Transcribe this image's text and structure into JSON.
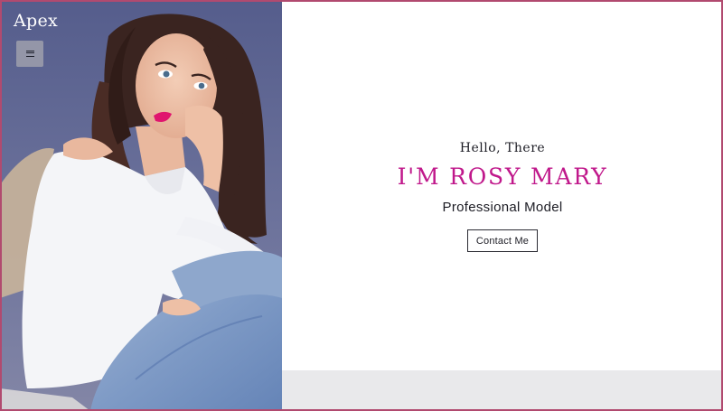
{
  "brand": {
    "name": "Apex"
  },
  "nav": {
    "menu_icon": "hamburger-menu-icon"
  },
  "hero": {
    "greeting": "Hello, There",
    "headline": "I'M ROSY MARY",
    "role": "Professional Model",
    "cta_label": "Contact Me"
  },
  "photo": {
    "subject": "model-portrait"
  },
  "colors": {
    "accent": "#c0188b",
    "frame": "#b14a6f",
    "photo_background": "#5f6690",
    "footer_strip": "#e9e9eb"
  }
}
